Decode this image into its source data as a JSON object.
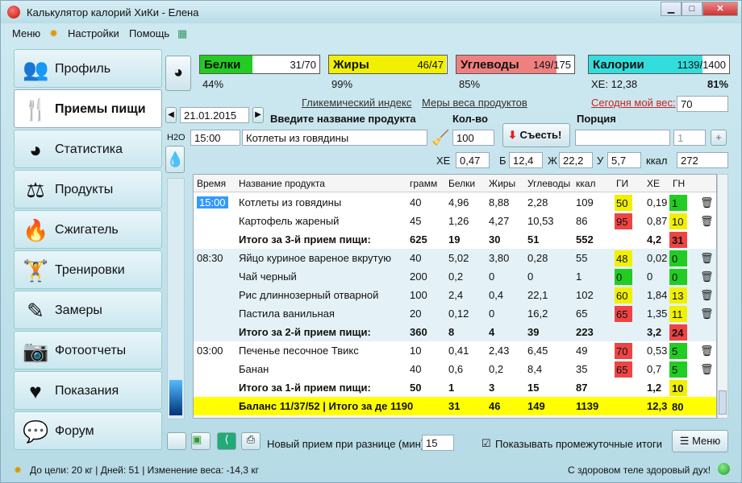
{
  "window": {
    "title": "Калькулятор калорий ХиКи - Елена"
  },
  "menu": [
    "Меню",
    "Настройки",
    "Помощь"
  ],
  "sidebar": [
    {
      "label": "Профиль",
      "icon": "people-icon"
    },
    {
      "label": "Приемы пищи",
      "icon": "fork-knife-icon"
    },
    {
      "label": "Статистика",
      "icon": "pie-chart-icon"
    },
    {
      "label": "Продукты",
      "icon": "scale-icon"
    },
    {
      "label": "Сжигатель",
      "icon": "flame-icon"
    },
    {
      "label": "Тренировки",
      "icon": "dumbbell-icon"
    },
    {
      "label": "Замеры",
      "icon": "pencil-icon"
    },
    {
      "label": "Фотоотчеты",
      "icon": "camera-icon"
    },
    {
      "label": "Показания",
      "icon": "heart-icon"
    },
    {
      "label": "Форум",
      "icon": "chat-icon"
    }
  ],
  "meters": [
    {
      "name": "Белки",
      "value": "31/70",
      "pct": "44%",
      "fill": 0.44,
      "color": "#22cc22"
    },
    {
      "name": "Жиры",
      "value": "46/47",
      "pct": "99%",
      "fill": 0.99,
      "color": "#f0f000"
    },
    {
      "name": "Углеводы",
      "value": "149/175",
      "pct": "85%",
      "fill": 0.85,
      "color": "#f08080"
    },
    {
      "name": "Калории",
      "value": "1139/1400",
      "pct": "81%",
      "fill": 0.81,
      "color": "#33dddd"
    }
  ],
  "xe_total": "ХЕ: 12,38",
  "links": {
    "gi": "Гликемический индекс",
    "weights": "Меры веса продуктов",
    "weight_today": "Сегодня мой вес:"
  },
  "weight_value": "70",
  "date": "21.01.2015",
  "labels": {
    "enter_product": "Введите название продукта",
    "qty": "Кол-во",
    "portion": "Порция",
    "eat": "Съесть!",
    "h2o": "H2O",
    "xe": "ХЕ",
    "b": "Б",
    "zh": "Ж",
    "u": "У",
    "kcal": "ккал"
  },
  "form": {
    "time": "15:00",
    "product": "Котлеты из говядины",
    "qty": "100",
    "portion_count": "1",
    "xe": "0,47",
    "b": "12,4",
    "zh": "22,2",
    "u": "5,7",
    "kcal": "272"
  },
  "table": {
    "headers": [
      "Время",
      "Название продукта",
      "грамм",
      "Белки",
      "Жиры",
      "Углеводы",
      "ккал",
      "ГИ",
      "ХЕ",
      "ГН"
    ],
    "rows": [
      {
        "time": "15:00",
        "name": "Котлеты из говядины",
        "g": "40",
        "b": "4,96",
        "zh": "8,88",
        "u": "2,28",
        "kcal": "109",
        "gi": "50",
        "gic": "#f0f000",
        "xe": "0,19",
        "gn": "1",
        "gnc": "#22cc22",
        "type": "item",
        "alt": false
      },
      {
        "time": "",
        "name": "Картофель жареный",
        "g": "45",
        "b": "1,26",
        "zh": "4,27",
        "u": "10,53",
        "kcal": "86",
        "gi": "95",
        "gic": "#ee4444",
        "xe": "0,87",
        "gn": "10",
        "gnc": "#f0f000",
        "type": "item",
        "alt": false
      },
      {
        "time": "",
        "name": "Итого за 3-й прием пищи:",
        "g": "625",
        "b": "19",
        "zh": "30",
        "u": "51",
        "kcal": "552",
        "gi": "",
        "gic": "",
        "xe": "4,2",
        "gn": "31",
        "gnc": "#ee4444",
        "type": "total",
        "alt": false
      },
      {
        "time": "08:30",
        "name": "Яйцо куриное вареное вкрутую",
        "g": "40",
        "b": "5,02",
        "zh": "3,80",
        "u": "0,28",
        "kcal": "55",
        "gi": "48",
        "gic": "#f0f000",
        "xe": "0,02",
        "gn": "0",
        "gnc": "#22cc22",
        "type": "item",
        "alt": true
      },
      {
        "time": "",
        "name": "Чай черный",
        "g": "200",
        "b": "0,2",
        "zh": "0",
        "u": "0",
        "kcal": "1",
        "gi": "0",
        "gic": "#22cc22",
        "xe": "0",
        "gn": "0",
        "gnc": "#22cc22",
        "type": "item",
        "alt": true
      },
      {
        "time": "",
        "name": "Рис длиннозерный отварной",
        "g": "100",
        "b": "2,4",
        "zh": "0,4",
        "u": "22,1",
        "kcal": "102",
        "gi": "60",
        "gic": "#f0f000",
        "xe": "1,84",
        "gn": "13",
        "gnc": "#f0f000",
        "type": "item",
        "alt": true
      },
      {
        "time": "",
        "name": "Пастила ванильная",
        "g": "20",
        "b": "0,12",
        "zh": "0",
        "u": "16,2",
        "kcal": "65",
        "gi": "65",
        "gic": "#ee4444",
        "xe": "1,35",
        "gn": "11",
        "gnc": "#f0f000",
        "type": "item",
        "alt": true
      },
      {
        "time": "",
        "name": "Итого за 2-й прием пищи:",
        "g": "360",
        "b": "8",
        "zh": "4",
        "u": "39",
        "kcal": "223",
        "gi": "",
        "gic": "",
        "xe": "3,2",
        "gn": "24",
        "gnc": "#ee4444",
        "type": "total",
        "alt": true
      },
      {
        "time": "03:00",
        "name": "Печенье песочное Твикс",
        "g": "10",
        "b": "0,41",
        "zh": "2,43",
        "u": "6,45",
        "kcal": "49",
        "gi": "70",
        "gic": "#ee4444",
        "xe": "0,53",
        "gn": "5",
        "gnc": "#22cc22",
        "type": "item",
        "alt": false
      },
      {
        "time": "",
        "name": "Банан",
        "g": "40",
        "b": "0,6",
        "zh": "0,2",
        "u": "8,4",
        "kcal": "35",
        "gi": "65",
        "gic": "#ee4444",
        "xe": "0,7",
        "gn": "5",
        "gnc": "#22cc22",
        "type": "item",
        "alt": false
      },
      {
        "time": "",
        "name": "Итого за 1-й прием пищи:",
        "g": "50",
        "b": "1",
        "zh": "3",
        "u": "15",
        "kcal": "87",
        "gi": "",
        "gic": "",
        "xe": "1,2",
        "gn": "10",
        "gnc": "#f0f000",
        "type": "total",
        "alt": false
      },
      {
        "time": "",
        "name": "Баланс 11/37/52  |  Итого за де 1190",
        "g": "",
        "b": "31",
        "zh": "46",
        "u": "149",
        "kcal": "1139",
        "gi": "",
        "gic": "",
        "xe": "12,3",
        "gn": "80",
        "gnc": "",
        "type": "balance",
        "alt": false
      }
    ]
  },
  "bottom": {
    "new_meal_label": "Новый прием при разнице (мин)",
    "new_meal_value": "15",
    "show_totals": "Показывать промежуточные итоги",
    "menu_button": "Меню"
  },
  "status": {
    "left": "До цели: 20 кг | Дней: 51 | Изменение веса: -14,3 кг",
    "right": "С здоровом теле здоровый дух!"
  }
}
